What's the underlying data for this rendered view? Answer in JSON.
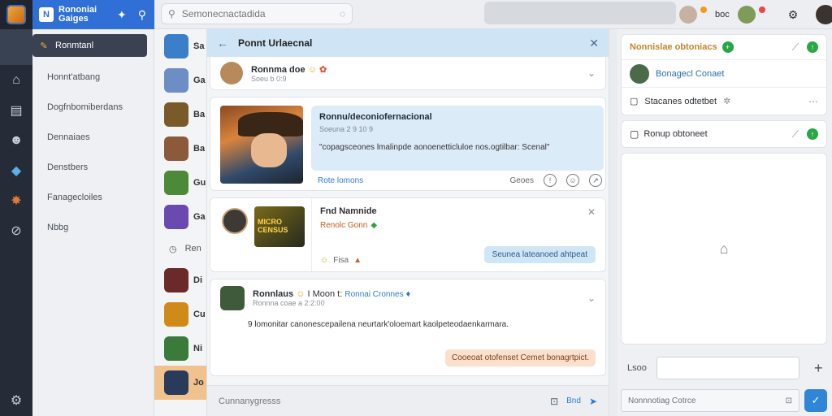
{
  "topbar": {
    "brand": "Rononiai Gaiges",
    "search_placeholder": "Semonecnactadida",
    "user_label": "boc"
  },
  "menu": {
    "items": [
      {
        "label": "Ronmtanl",
        "icon": "puzzle-icon"
      },
      {
        "label": "Honnt'atbang",
        "icon": "bag-icon"
      },
      {
        "label": "Dogfnbomiberdans",
        "icon": "list-icon"
      },
      {
        "label": "Dennaiaes",
        "icon": "people-icon"
      },
      {
        "label": "Denstbers",
        "icon": "game-icon"
      },
      {
        "label": "Fanagecloiles",
        "icon": "trophy-icon"
      },
      {
        "label": "Nbbg",
        "icon": "link-icon"
      }
    ]
  },
  "convos": {
    "items": [
      "Sa",
      "Ga",
      "Ba",
      "Ba",
      "Gu",
      "Ga"
    ],
    "section_label": "Ren",
    "items2": [
      "Di",
      "Cu",
      "Ni",
      "Jo"
    ]
  },
  "main": {
    "title": "Ponnt Urlaecnal",
    "post1": {
      "name": "Ronnma doe",
      "meta": "Soeu b 0:9"
    },
    "hero": {
      "title": "Ronnu/deconiofernacional",
      "meta": "Soeuna 2 9 10 9",
      "body": "\"copagsceones lmalinpde aonoenetticluloe nos.ogtilbar: Scenal\"",
      "link": "Rote lomons",
      "action": "Geoes"
    },
    "find": {
      "badge_text": "MICRO CENSUS",
      "title": "Fnd Namnide",
      "subtitle": "Renolc Gonn",
      "foot": "Fisa",
      "button": "Seunea lateanoed ahtpeat"
    },
    "post2": {
      "name": "Ronnlaus",
      "mid": "I Moon t:",
      "link": "Ronnai Cronnes",
      "meta": "Ronnna coae a 2:2:00",
      "body": "9  lomonitar canonescepailena neurtark'oloemart kaolpeteodaenkarmara.",
      "button": "Cooeoat otofenset Cemet bonagrtpict."
    },
    "composer": {
      "placeholder": "Cunnanygresss",
      "send_label": "Bnd"
    }
  },
  "right": {
    "card1": {
      "title": "Nonnislae obtoniacs",
      "link": "Bonagecl Conaet",
      "row2": "Stacanes odtetbet"
    },
    "card2": {
      "title": "Ronup obtoneet"
    },
    "input_label": "Lsoo",
    "compose_placeholder": "Nonnnotiag Cotrce"
  },
  "colors": {
    "accent": "#2f6fd6",
    "rail": "#262c37",
    "header": "#cfe5f6"
  }
}
